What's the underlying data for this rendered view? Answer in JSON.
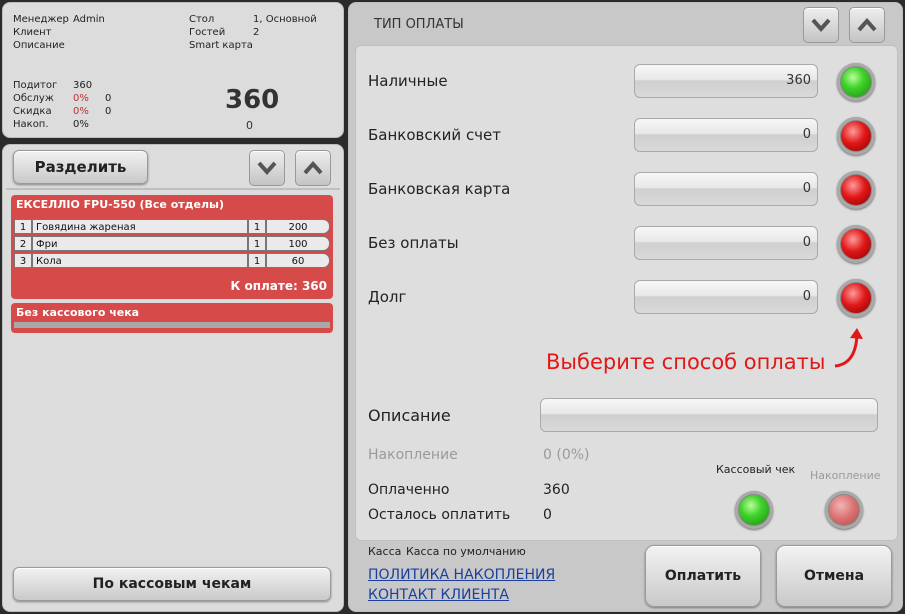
{
  "order_info": {
    "manager_label": "Менеджер",
    "manager_value": "Admin",
    "client_label": "Клиент",
    "description_label": "Описание",
    "table_label": "Стол",
    "table_value": "1, Основной",
    "guests_label": "Гостей",
    "guests_value": "2",
    "card_label": "Smart карта",
    "subtotal_label": "Подитог",
    "subtotal_value": "360",
    "service_label": "Обслуж",
    "service_pct": "0%",
    "service_value": "0",
    "discount_label": "Скидка",
    "discount_pct": "0%",
    "discount_value": "0",
    "accum_label": "Накоп.",
    "accum_pct": "0%",
    "total_big": "360",
    "total_small": "0"
  },
  "split": {
    "split_label": "Разделить",
    "check": {
      "title": "ЕКСЕЛЛІО FPU-550 (Все отделы)",
      "items": [
        {
          "num": "1",
          "name": "Говядина жареная",
          "qty": "1",
          "price": "200"
        },
        {
          "num": "2",
          "name": "Фри",
          "qty": "1",
          "price": "100"
        },
        {
          "num": "3",
          "name": "Кола",
          "qty": "1",
          "price": "60"
        }
      ],
      "to_pay": "К оплате: 360"
    },
    "no_receipt": "Без кассового чека",
    "by_receipts_label": "По кассовым чекам"
  },
  "payment": {
    "title": "ТИП ОПЛАТЫ",
    "methods": [
      {
        "label": "Наличные",
        "value": "360",
        "state": "green"
      },
      {
        "label": "Банковский счет",
        "value": "0",
        "state": "red"
      },
      {
        "label": "Банковская карта",
        "value": "0",
        "state": "red"
      },
      {
        "label": "Без оплаты",
        "value": "0",
        "state": "red"
      },
      {
        "label": "Долг",
        "value": "0",
        "state": "red"
      }
    ],
    "hint": "Выберите способ оплаты",
    "description_label": "Описание",
    "description_value": "",
    "accumulation_label": "Накопление",
    "accumulation_value": "0 (0%)",
    "paid_label": "Оплаченно",
    "paid_value": "360",
    "remaining_label": "Осталось оплатить",
    "remaining_value": "0",
    "receipt_toggle_label": "Кассовый чек",
    "accum_toggle_label": "Накопление",
    "register_label": "Касса",
    "register_value": "Касса по умолчанию",
    "link_policy": "ПОЛИТИКА НАКОПЛЕНИЯ",
    "link_contact": "КОНТАКТ КЛИЕНТА",
    "pay_button": "Оплатить",
    "cancel_button": "Отмена"
  },
  "colors": {
    "accent_red": "#d64a4a",
    "hint_red": "#e01818",
    "link_blue": "#1a3f9e",
    "panel_gray": "#dcdcdc"
  }
}
